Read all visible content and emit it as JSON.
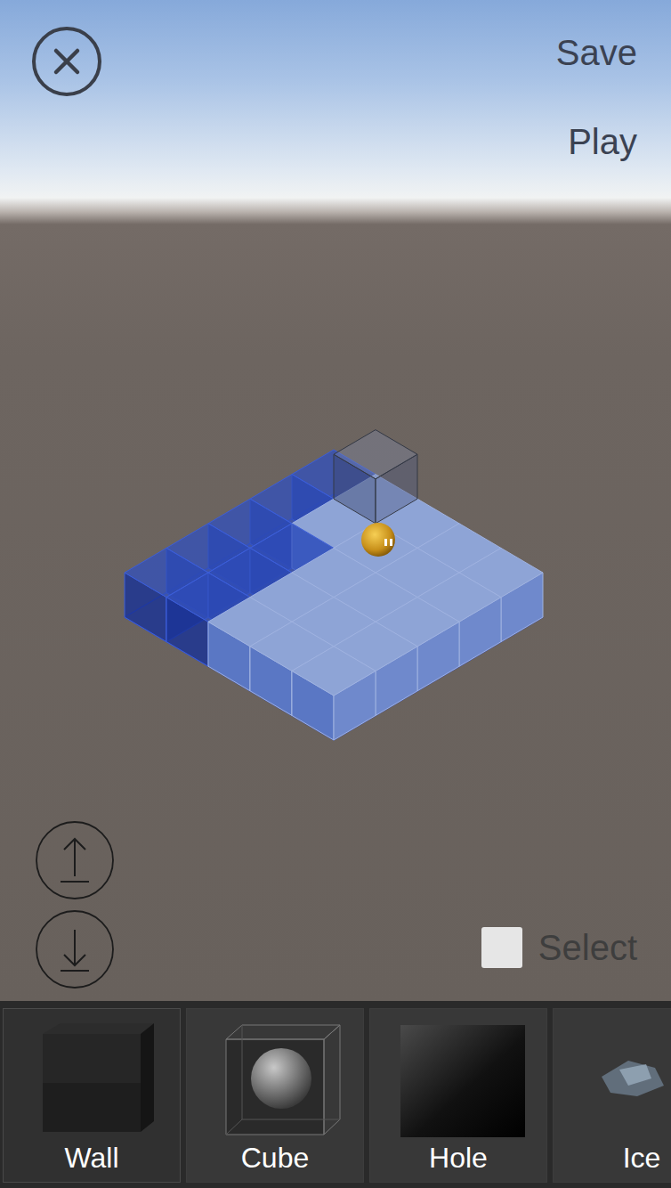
{
  "actions": [
    "Save",
    "Play"
  ],
  "select": {
    "label": "Select",
    "checked": false
  },
  "palette": [
    {
      "label": "Wall",
      "selected": true,
      "kind": "wall"
    },
    {
      "label": "Cube",
      "selected": false,
      "kind": "cube"
    },
    {
      "label": "Hole",
      "selected": false,
      "kind": "hole"
    },
    {
      "label": "Ice",
      "selected": false,
      "kind": "ice"
    }
  ]
}
